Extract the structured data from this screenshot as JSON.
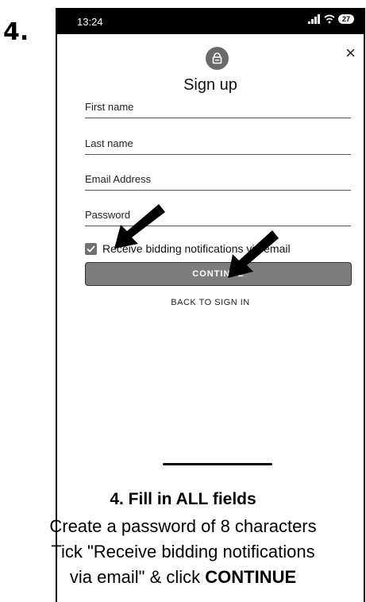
{
  "step_marker": "4.",
  "status_bar": {
    "time": "13:24",
    "signal": ".ıl",
    "wifi": "≈",
    "battery": "27"
  },
  "screen": {
    "title": "Sign up",
    "fields": {
      "first_name": "First name",
      "last_name": "Last name",
      "email": "Email Address",
      "password": "Password"
    },
    "checkbox_label": "Receive bidding notifications via email",
    "checkbox_checked": true,
    "continue_label": "CONTINUE",
    "back_label": "BACK TO SIGN IN",
    "close_symbol": "×"
  },
  "caption": {
    "title": "4. Fill in ALL fields",
    "line1": "Create a password of 8 characters",
    "line2": "Tick \"Receive bidding notifications",
    "line3_prefix": "via email\" & click ",
    "line3_bold": "CONTINUE"
  },
  "colors": {
    "button": "#7d7d7d",
    "checkbox": "#707070",
    "status_bar": "#000000",
    "arrow": "#000000"
  }
}
